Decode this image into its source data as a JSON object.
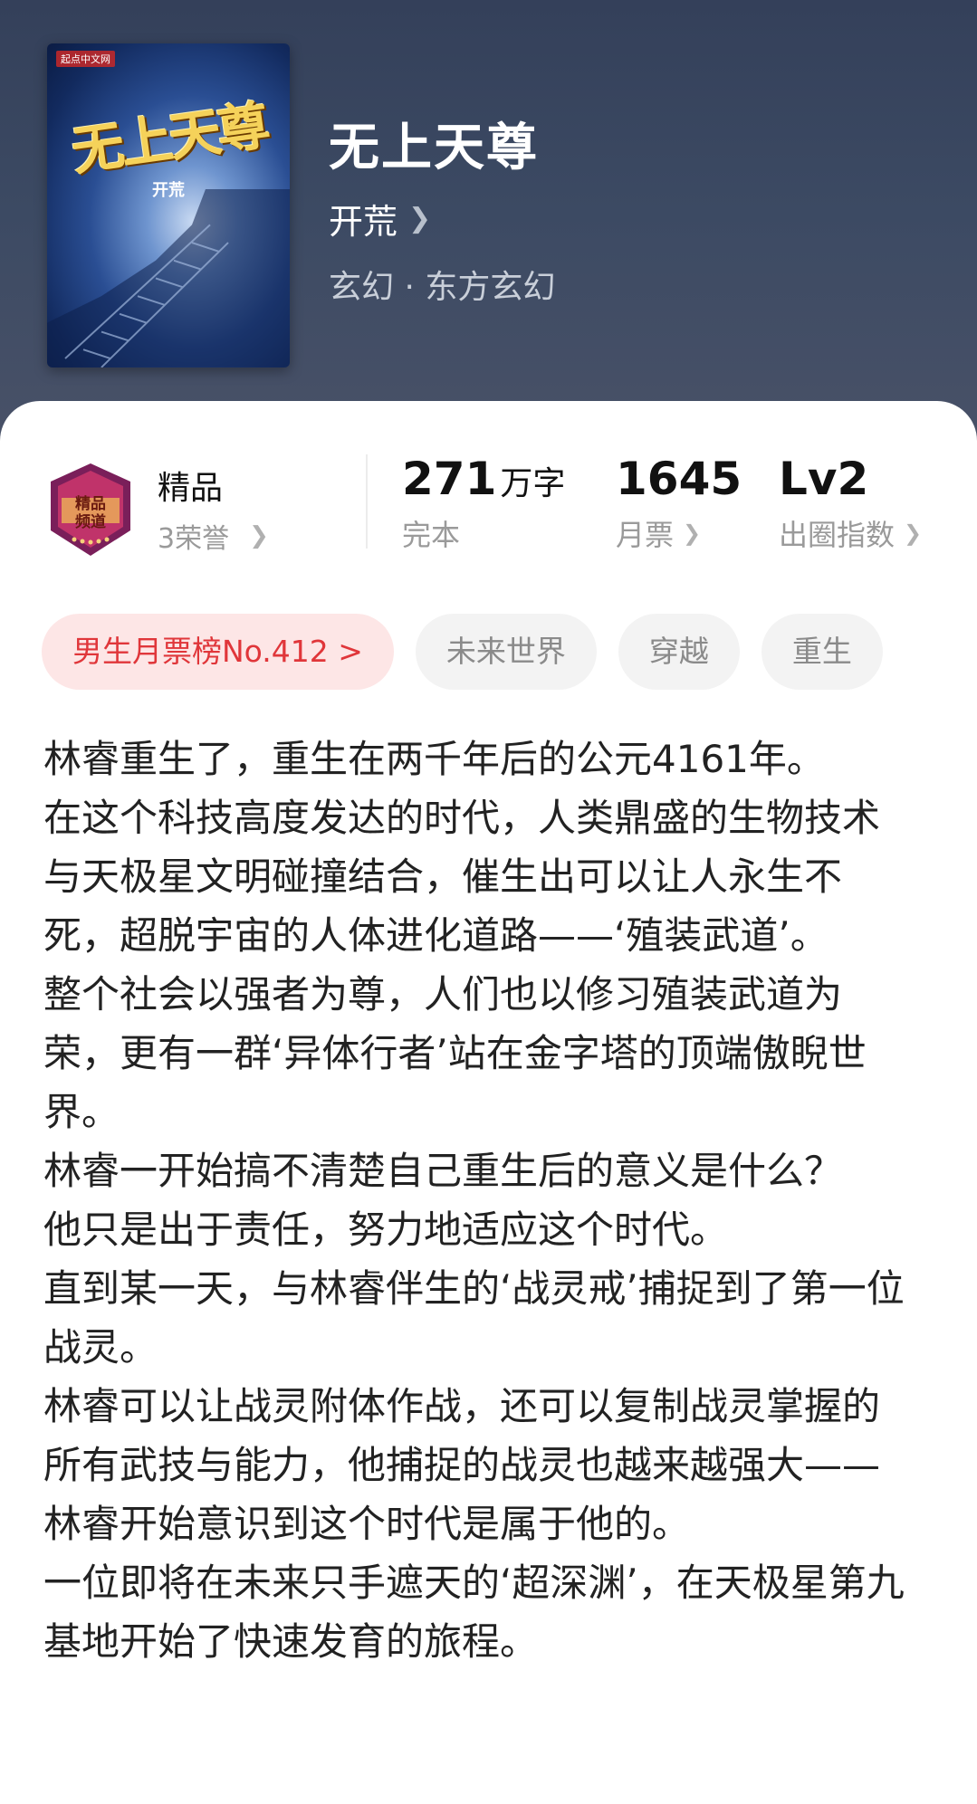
{
  "book": {
    "title": "无上天尊",
    "author": "开荒",
    "genre": "玄幻 · 东方玄幻",
    "cover": {
      "title_art": "无上天尊",
      "author_art": "开荒",
      "publisher_logo": "起点中文网"
    }
  },
  "honor": {
    "badge_text": "精品频道",
    "title": "精品",
    "count": "3荣誉"
  },
  "stats": [
    {
      "value": "271",
      "unit": "万字",
      "label": "完本"
    },
    {
      "value": "1645",
      "unit": "",
      "label": "月票"
    },
    {
      "value": "Lv2",
      "unit": "",
      "label": "出圈指数"
    }
  ],
  "tags": [
    "男生月票榜No.412 >",
    "未来世界",
    "穿越",
    "重生"
  ],
  "description": [
    "林睿重生了，重生在两千年后的公元4161年。",
    "在这个科技高度发达的时代，人类鼎盛的生物技术与天极星文明碰撞结合，催生出可以让人永生不死，超脱宇宙的人体进化道路——‘殖装武道’。",
    "整个社会以强者为尊，人们也以修习殖装武道为荣，更有一群‘异体行者’站在金字塔的顶端傲睨世界。",
    "林睿一开始搞不清楚自己重生后的意义是什么？",
    "他只是出于责任，努力地适应这个时代。",
    "直到某一天，与林睿伴生的‘战灵戒’捕捉到了第一位战灵。",
    "林睿可以让战灵附体作战，还可以复制战灵掌握的所有武技与能力，他捕捉的战灵也越来越强大——",
    "林睿开始意识到这个时代是属于他的。",
    "一位即将在未来只手遮天的‘超深渊’，在天极星第九基地开始了快速发育的旅程。"
  ],
  "icons": {
    "chevron": "chevron-right-icon",
    "badge": "quality-channel-badge-icon"
  },
  "colors": {
    "rank_tag_bg": "#fde6e6",
    "rank_tag_text": "#e0363a",
    "hero_bg": "#3c4a63"
  }
}
